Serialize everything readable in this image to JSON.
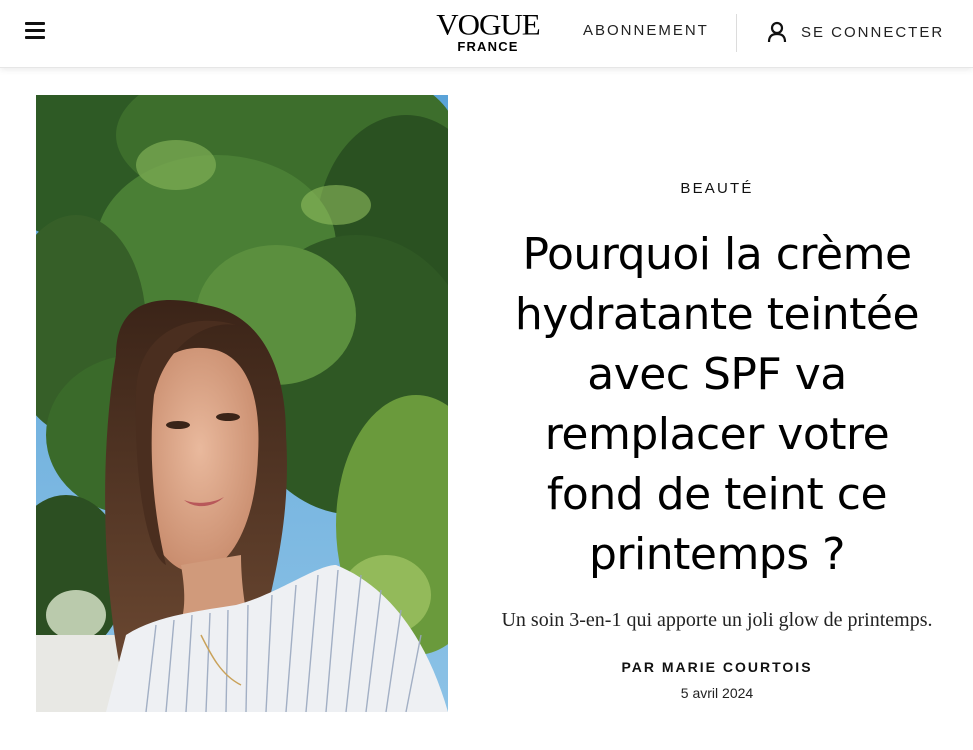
{
  "header": {
    "logo": "VOGUE",
    "logo_sub": "FRANCE",
    "subscribe_label": "ABONNEMENT",
    "login_label": "SE CONNECTER"
  },
  "hero": {
    "alt": "Femme aux cheveux bruns en chemise rayée devant des arbres"
  },
  "article": {
    "rubric": "BEAUTÉ",
    "headline": "Pourquoi la crème hydratante teintée avec SPF va remplacer votre fond de teint ce printemps ?",
    "dek": "Un soin 3-en-1 qui apporte un joli glow de printemps.",
    "byline_prefix": "PAR ",
    "author": "MARIE COURTOIS",
    "date": "5 avril 2024"
  },
  "icons": [
    "menu-icon",
    "user-icon"
  ]
}
